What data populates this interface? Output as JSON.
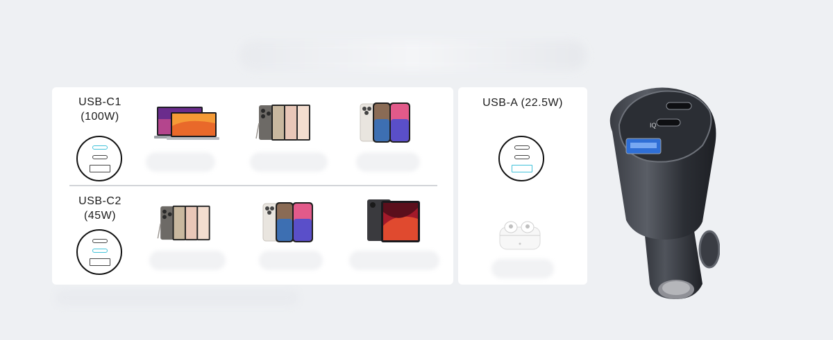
{
  "ports": {
    "c1": {
      "name": "USB-C1",
      "power": "(100W)"
    },
    "c2": {
      "name": "USB-C2",
      "power": "(45W)"
    },
    "a": {
      "label": "USB-A (22.5W)"
    }
  },
  "devices": {
    "c1": [
      "laptop",
      "android-phones",
      "iphones"
    ],
    "c2": [
      "android-phones",
      "iphones",
      "tablets"
    ],
    "a": [
      "earbuds"
    ]
  },
  "colors": {
    "active_port": "#3fc1d9",
    "charger_body": "#2a2d33",
    "panel": "#ffffff",
    "background": "#eef0f3"
  },
  "icons": [
    "usb-port-icon",
    "laptop-icon",
    "phone-icon",
    "tablet-icon",
    "earbuds-icon",
    "car-charger-icon"
  ]
}
